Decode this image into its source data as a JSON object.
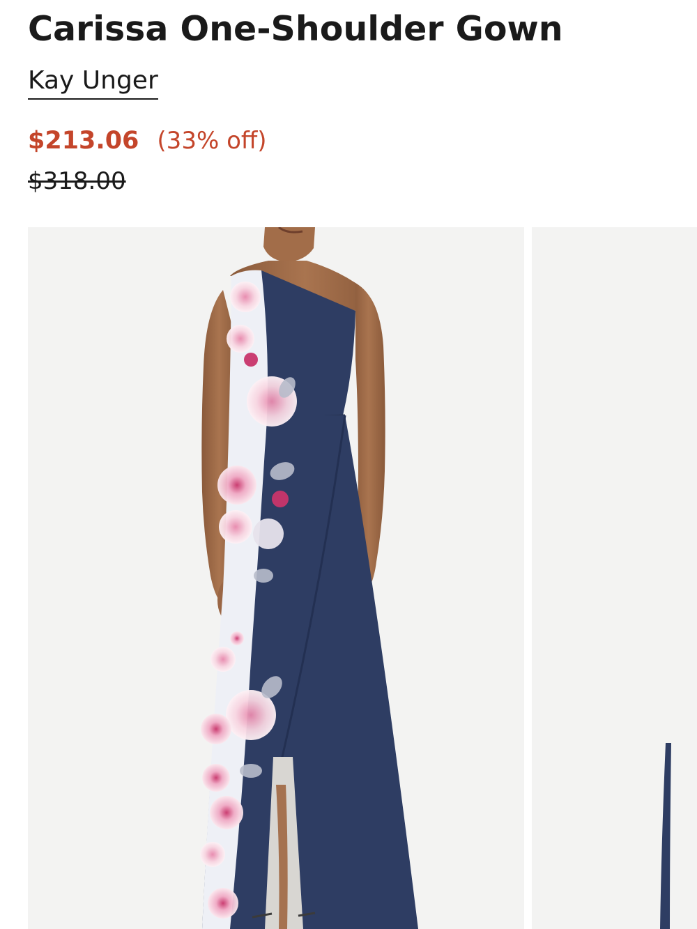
{
  "product": {
    "title": "Carissa One-Shoulder Gown",
    "brand": "Kay Unger",
    "sale_price": "$213.06",
    "discount": "(33% off)",
    "original_price": "$318.00"
  },
  "colors": {
    "sale": "#c4452a",
    "text": "#1a1a1a",
    "image_background": "#f3f3f2",
    "gown_navy": "#2e3d63"
  },
  "gallery": {
    "images": [
      {
        "subject": "model-wearing-navy-floral-one-shoulder-gown"
      },
      {
        "subject": "gown-alternate-view-partially-visible"
      }
    ]
  }
}
